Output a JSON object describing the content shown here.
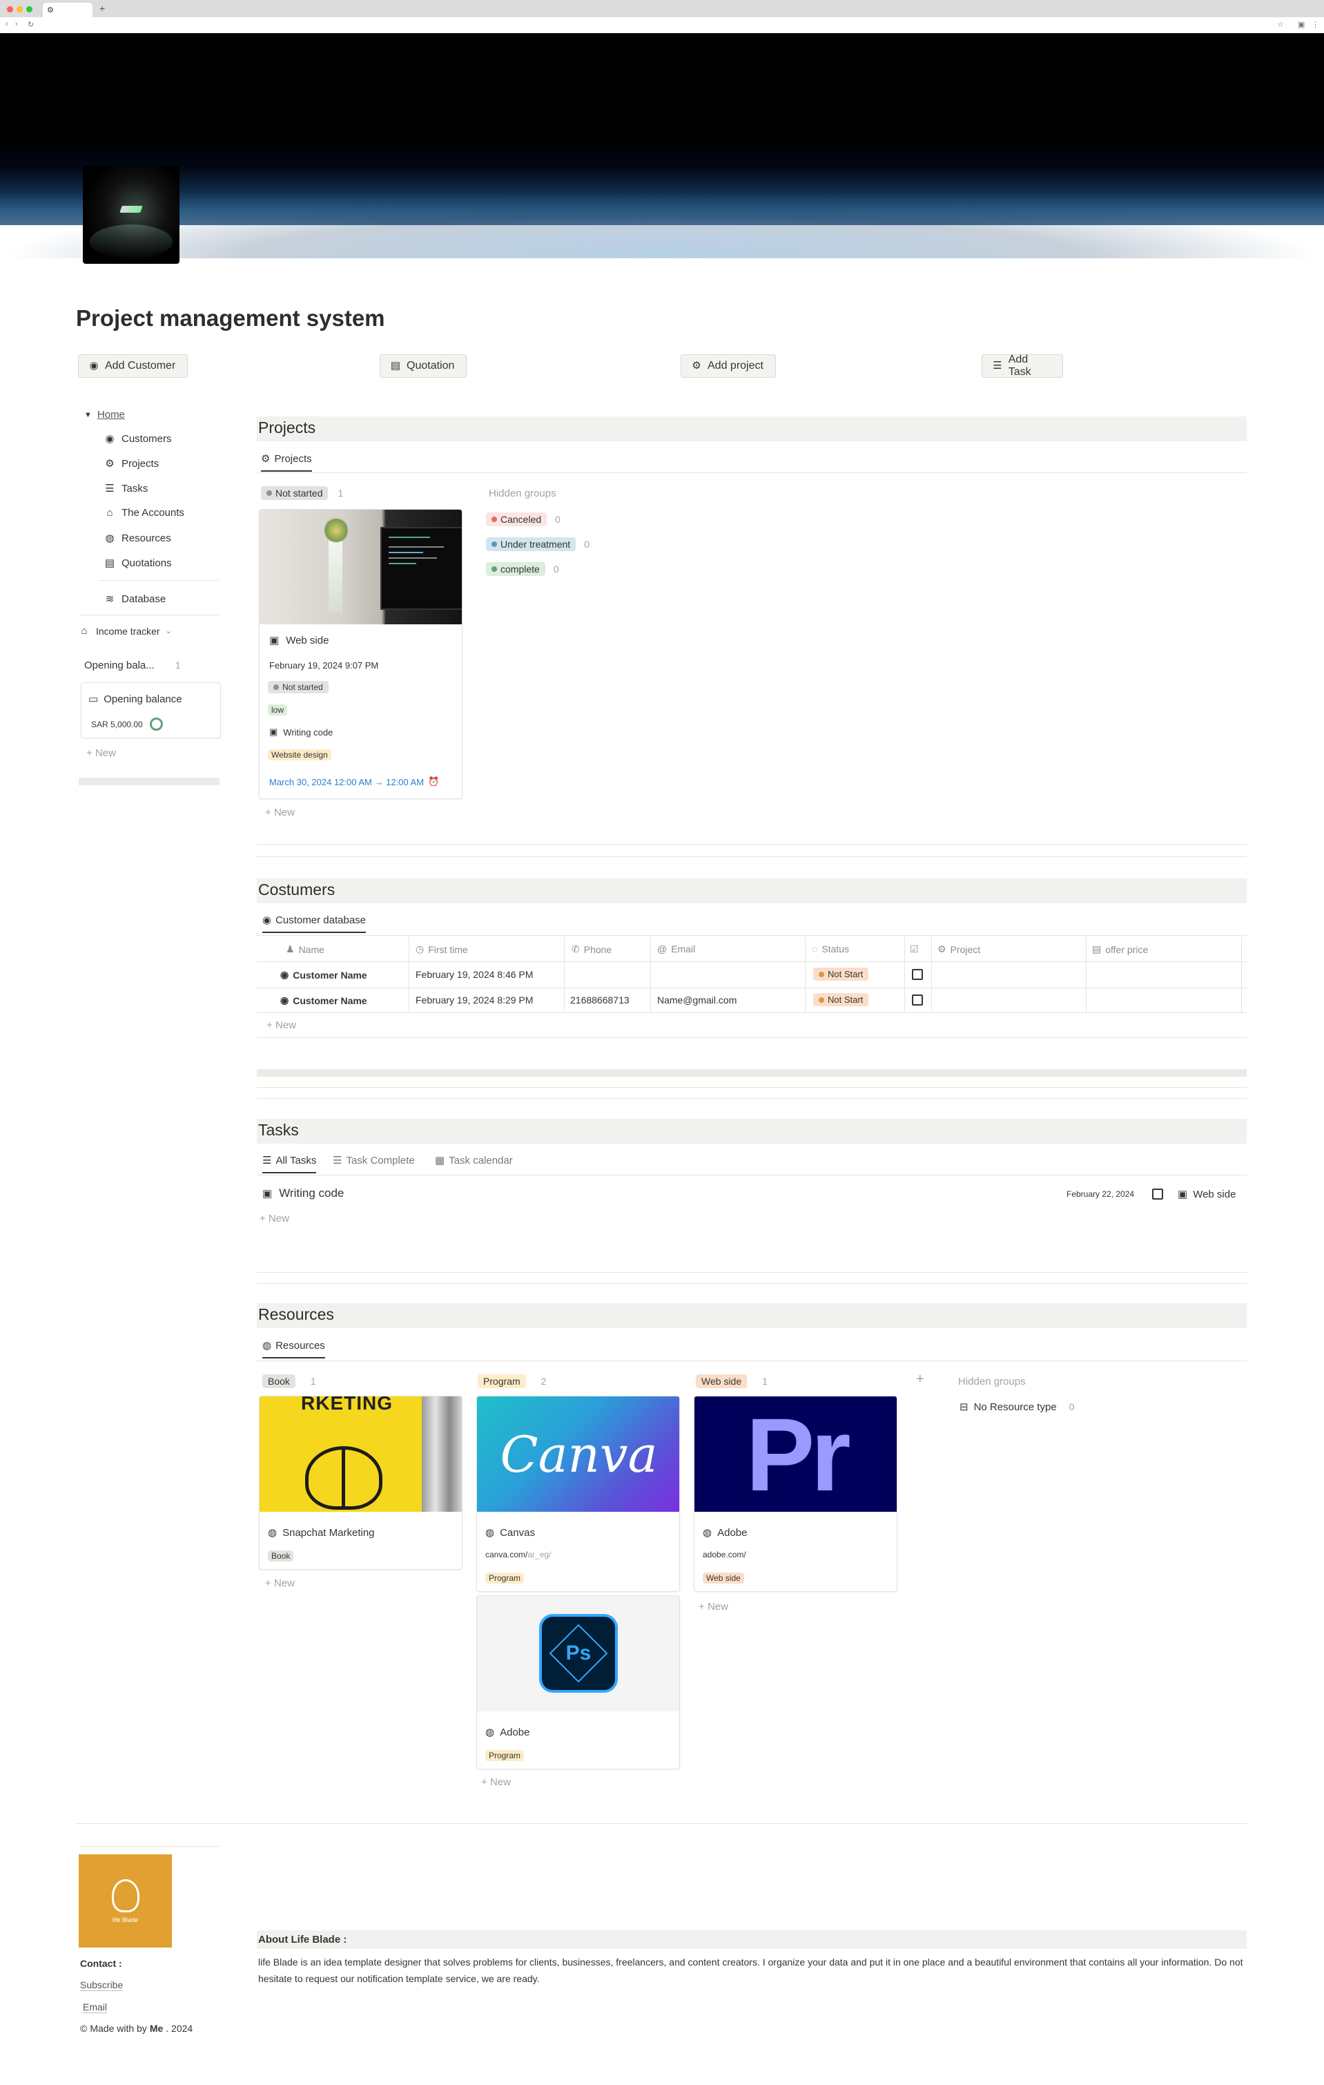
{
  "browser": {
    "tab_title": "",
    "new_tab": "+"
  },
  "page": {
    "title": "Project management system"
  },
  "quick_actions": [
    {
      "label": "Add Customer",
      "icon": "customer-icon"
    },
    {
      "label": "Quotation",
      "icon": "document-icon"
    },
    {
      "label": "Add project",
      "icon": "gear-icon"
    },
    {
      "label": "Add Task",
      "icon": "checklist-icon"
    }
  ],
  "sidebar": {
    "home": "Home",
    "items": [
      {
        "label": "Customers",
        "icon": "customer-icon"
      },
      {
        "label": "Projects",
        "icon": "gear-icon"
      },
      {
        "label": "Tasks",
        "icon": "checklist-icon"
      },
      {
        "label": "The Accounts",
        "icon": "bank-icon"
      },
      {
        "label": "Resources",
        "icon": "globe-icon"
      },
      {
        "label": "Quotations",
        "icon": "document-icon"
      }
    ],
    "database": "Database",
    "income_tracker": "Income tracker",
    "opening_group": "Opening bala...",
    "opening_count": "1",
    "opening_card_title": "Opening balance",
    "opening_card_amount": "SAR 5,000.00",
    "new": "New"
  },
  "projects": {
    "title": "Projects",
    "view_tab": "Projects",
    "group_label": "Not started",
    "group_count": "1",
    "hidden_groups_label": "Hidden groups",
    "hidden_groups": [
      {
        "label": "Canceled",
        "count": "0",
        "bg": "#fbe4e4",
        "dot": "#e16f64"
      },
      {
        "label": "Under treatment",
        "count": "0",
        "bg": "#d3e5ef",
        "dot": "#5b97bd"
      },
      {
        "label": "complete",
        "count": "0",
        "bg": "#dbeddb",
        "dot": "#6c9b7d"
      }
    ],
    "card": {
      "title": "Web side",
      "date": "February 19, 2024 9:07 PM",
      "status": "Not started",
      "priority": "low",
      "task": "Writing code",
      "category": "Website design",
      "range": "March 30, 2024 12:00 AM → 12:00 AM"
    },
    "new": "New"
  },
  "customers": {
    "title": "Costumers",
    "view_tab": "Customer database",
    "columns": [
      "Name",
      "First time",
      "Phone",
      "Email",
      "Status",
      "",
      "Project",
      "offer price"
    ],
    "rows": [
      {
        "name": "Customer Name",
        "first_time": "February 19, 2024 8:46 PM",
        "phone": "",
        "email": "",
        "status": "Not Start"
      },
      {
        "name": "Customer Name",
        "first_time": "February 19, 2024 8:29 PM",
        "phone": "21688668713",
        "email": "Name@gmail.com",
        "status": "Not Start"
      }
    ],
    "new": "New"
  },
  "tasks": {
    "title": "Tasks",
    "tabs": [
      "All Tasks",
      "Task Complete",
      "Task calendar"
    ],
    "item": {
      "title": "Writing code",
      "date": "February 22, 2024",
      "project": "Web side"
    },
    "new": "New"
  },
  "resources": {
    "title": "Resources",
    "view_tab": "Resources",
    "groups": [
      {
        "label": "Book",
        "count": "1",
        "bg": "#e3e2e0"
      },
      {
        "label": "Program",
        "count": "2",
        "bg": "#fdecc8"
      },
      {
        "label": "Web side",
        "count": "1",
        "bg": "#fadec9"
      }
    ],
    "add": "+",
    "hidden_groups_label": "Hidden groups",
    "hidden_group": {
      "label": "No Resource type",
      "count": "0"
    },
    "cards": [
      {
        "title": "Snapchat Marketing",
        "tag": "Book",
        "cover_text": "RKETING"
      },
      {
        "title": "Canvas",
        "url_main": "canva.com/",
        "url_dim": "ar_eg/",
        "tag": "Program",
        "cover_text": "Canva"
      },
      {
        "title": "Adobe",
        "url_main": "adobe.com/",
        "url_dim": "",
        "tag": "Web side",
        "cover_text": "Pr"
      },
      {
        "title": "Adobe",
        "tag": "Program",
        "cover_text": "Ps"
      }
    ],
    "new": "New"
  },
  "footer": {
    "logo_text": "life Blade",
    "contact_label": "Contact :",
    "subscribe": "Subscribe",
    "email": "Email",
    "made_with": "Made with  by ",
    "made_by": "Me",
    "year": ". 2024",
    "about_title": "About Life Blade :",
    "about_text": "life Blade is an idea template designer that solves problems for clients, businesses, freelancers, and content creators. I organize your data and put it in one place and a beautiful environment that contains all your information. Do not hesitate to request our notification template service, we are ready."
  },
  "colors": {
    "accent_blue": "#2e7dd1",
    "tag_gray": "#e3e2e0",
    "tag_orange": "#fdecc8",
    "tag_green": "#dbeddb"
  }
}
